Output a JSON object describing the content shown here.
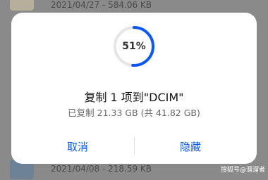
{
  "background": {
    "top_item": {
      "meta": "2021/04/27 - 584.06 KB"
    },
    "bottom_item": {
      "meta": "2021/04/08 - 218.59 KB"
    }
  },
  "dialog": {
    "progress": {
      "value": 0.51,
      "label": "51%"
    },
    "title": "复制 1 项到\"DCIM\"",
    "subtitle": "已复制 21.33 GB (共 41.82 GB)",
    "cancel_label": "取消",
    "hide_label": "隐藏"
  },
  "watermark": "搜狐号@溜溜者",
  "colors": {
    "accent": "#0a59f7",
    "track": "#e6e6e6"
  }
}
